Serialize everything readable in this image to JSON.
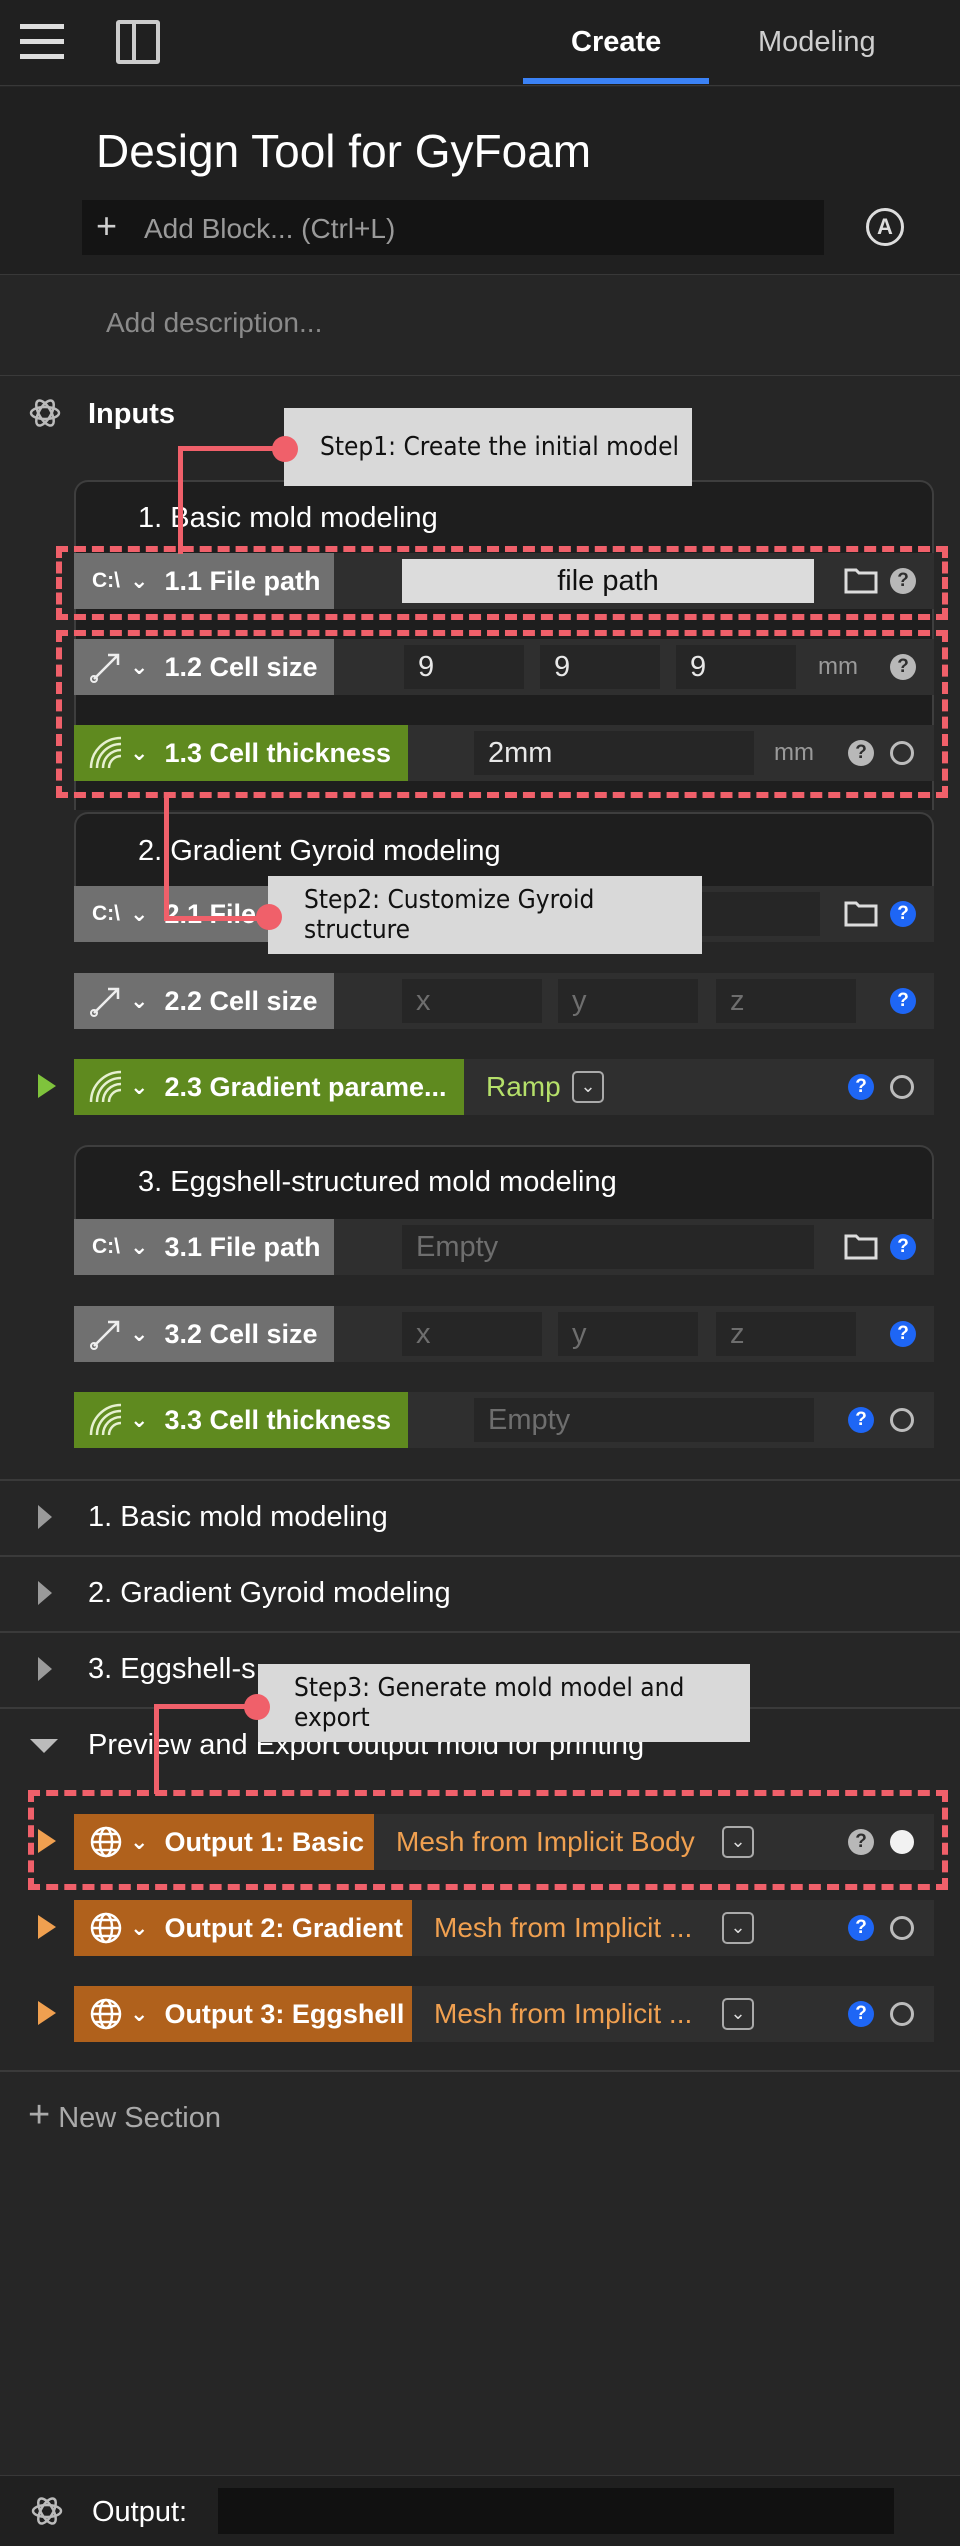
{
  "topbar": {
    "tabs": [
      "Create",
      "Modeling"
    ],
    "active_tab": "Create"
  },
  "header": {
    "title": "Design Tool for GyFoam",
    "add_block": "Add Block... (Ctrl+L)",
    "description_placeholder": "Add description..."
  },
  "inputs": {
    "label": "Inputs",
    "groups": [
      {
        "title": "1. Basic mold modeling",
        "rows": [
          {
            "label": "1.1 File path",
            "value": "file path"
          },
          {
            "label": "1.2 Cell size",
            "x": "9",
            "y": "9",
            "z": "9",
            "unit": "mm"
          },
          {
            "label": "1.3 Cell thickness",
            "value": "2mm",
            "unit": "mm"
          }
        ]
      },
      {
        "title": "2. Gradient Gyroid modeling",
        "rows": [
          {
            "label": "2.1 File"
          },
          {
            "label": "2.2 Cell size",
            "x_placeholder": "x",
            "y_placeholder": "y",
            "z_placeholder": "z"
          },
          {
            "label": "2.3 Gradient parame...",
            "value": "Ramp"
          }
        ]
      },
      {
        "title": "3. Eggshell-structured mold modeling",
        "rows": [
          {
            "label": "3.1 File path",
            "placeholder": "Empty"
          },
          {
            "label": "3.2 Cell size",
            "x_placeholder": "x",
            "y_placeholder": "y",
            "z_placeholder": "z"
          },
          {
            "label": "3.3 Cell thickness",
            "placeholder": "Empty"
          }
        ]
      }
    ]
  },
  "collapsed_sections": [
    "1. Basic mold modeling",
    "2. Gradient Gyroid modeling",
    "3. Eggshell-s"
  ],
  "preview": {
    "label": "Preview and Export output mold for printing",
    "outputs": [
      {
        "label": "Output 1: Basic",
        "value": "Mesh from Implicit Body"
      },
      {
        "label": "Output 2: Gradient",
        "value": "Mesh from Implicit ..."
      },
      {
        "label": "Output 3: Eggshell",
        "value": "Mesh from Implicit ..."
      }
    ]
  },
  "new_section": "New Section",
  "footer": {
    "output_label": "Output:"
  },
  "annotations": {
    "step1": "Step1: Create the initial model",
    "step2": "Step2: Customize Gyroid structure",
    "step3": "Step3: Generate mold model and export"
  },
  "colors": {
    "accent": "#3b82f6",
    "annotation": "#f0606a",
    "chip_gray": "#707070",
    "chip_green": "#5f8a1f",
    "chip_orange": "#b0611c",
    "ramp_text": "#b5e06a",
    "output_text": "#f0a050"
  }
}
